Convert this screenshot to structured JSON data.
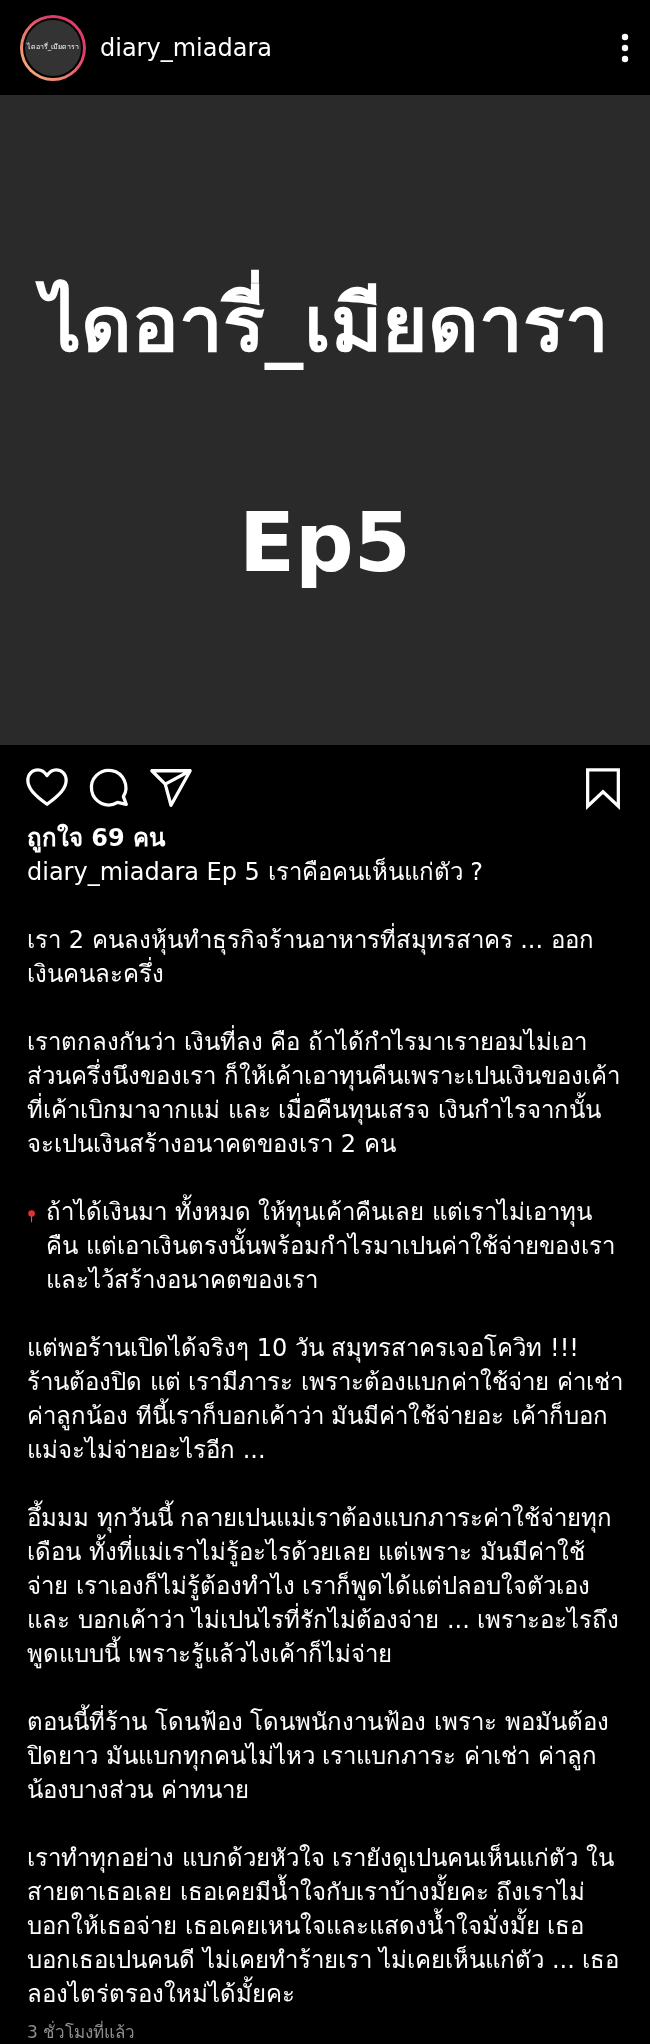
{
  "header": {
    "avatar_text": "ไดอารี่_เมียดารา",
    "username": "diary_miadara"
  },
  "post_image": {
    "title": "ไดอารี่_เมียดารา",
    "subtitle": "Ep5"
  },
  "actions": {
    "liked": false,
    "saved": false
  },
  "likes": "ถูกใจ 69 คน",
  "caption": {
    "username": "diary_miadara",
    "title": "Ep 5 เราคือคนเห็นแก่ตัว ?"
  },
  "paragraphs": [
    {
      "text": "เรา 2 คนลงหุ้นทำธุรกิจร้านอาหารที่สมุทรสาคร ... ออกเงินคนละครึ่ง",
      "pinned": false
    },
    {
      "text": "เราตกลงกันว่า เงินที่ลง คือ ถ้าได้กำไรมาเรายอมไม่เอาส่วนครึ่งนึงของเรา  ก็ให้เค้าเอาทุนคืนเพราะเปนเงินของเค้าที่เค้าเบิกมาจากแม่ และ เมื่อคืนทุนเสรจ เงินกำไรจากนั้น จะเปนเงินสร้างอนาคตของเรา 2 คน",
      "pinned": false
    },
    {
      "text": "ถ้าได้เงินมา ทั้งหมด ให้ทุนเค้าคืนเลย แต่เราไม่เอาทุนคืน แต่เอาเงินตรงนั้นพร้อมกำไรมาเปนค่าใช้จ่ายของเราและไว้สร้างอนาคตของเรา",
      "pinned": true
    },
    {
      "text": "แต่พอร้านเปิดได้จริงๆ 10 วัน สมุทรสาครเจอโควิท !!! ร้านต้องปิด แต่ เรามีภาระ เพราะต้องแบกค่าใช้จ่าย ค่าเช่า ค่าลูกน้อง ทีนี้เราก็บอกเค้าว่า มันมีค่าใช้จ่ายอะ เค้าก็บอกแม่จะไม่จ่ายอะไรอีก ...",
      "pinned": false
    },
    {
      "text": "อึ้มมม ทุกวันนี้ กลายเปนแม่เราต้องแบกภาระค่าใช้จ่ายทุกเดือน ทั้งที่แม่เราไม่รู้อะไรด้วยเลย แต่เพราะ มันมีค่าใช้จ่าย เราเองก็ไม่รู้ต้องทำไง เราก็พูดได้แต่ปลอบใจตัวเองและ บอกเค้าว่า ไม่เปนไรที่รักไม่ต้องจ่าย ... เพราะอะไรถึงพูดแบบนี้ เพราะรู้แล้วไงเค้าก็ไม่จ่าย",
      "pinned": false
    },
    {
      "text": "ตอนนี้ที่ร้าน โดนฟ้อง โดนพนักงานฟ้อง เพราะ พอมันต้องปิดยาว มันแบกทุกคนไม่ไหว เราแบกภาระ ค่าเช่า ค่าลูกน้องบางส่วน ค่าทนาย",
      "pinned": false
    },
    {
      "text": "เราทำทุกอย่าง แบกด้วยหัวใจ เรายังดูเปนคนเห็นแก่ตัว ในสายตาเธอเลย เธอเคยมีน้ำใจกับเราบ้างมั้ยคะ  ถึงเราไม่บอกให้เธอจ่าย เธอเคยเหนใจและแสดงน้ำใจมั่งมั้ย เธอบอกเธอเปนคนดี ไม่เคยทำร้ายเรา ไม่เคยเห็นแก่ตัว ... เธอลองไตร่ตรองใหม่ได้มั้ยคะ",
      "pinned": false
    }
  ],
  "timestamp": "3 ชั่วโมงที่แล้ว"
}
